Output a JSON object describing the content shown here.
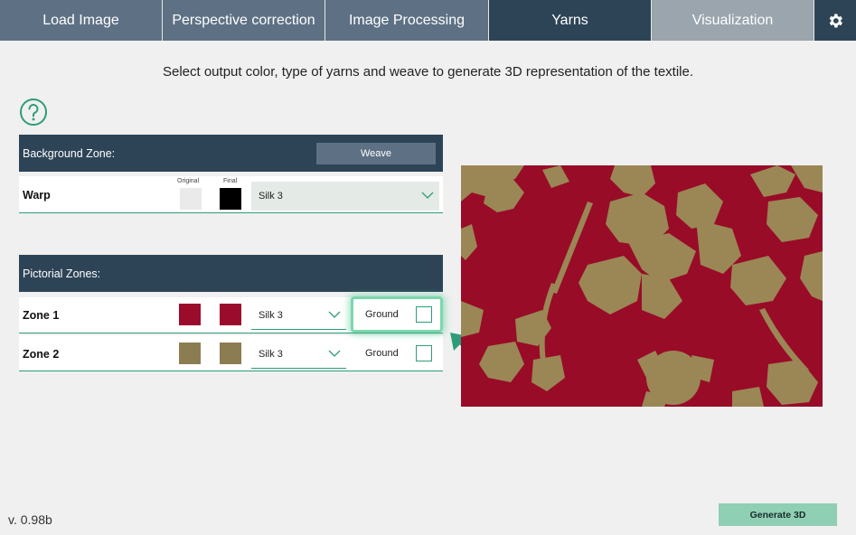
{
  "tabs": [
    {
      "label": "Load Image"
    },
    {
      "label": "Perspective correction"
    },
    {
      "label": "Image Processing"
    },
    {
      "label": "Yarns"
    },
    {
      "label": "Visualization"
    }
  ],
  "settings_icon": "gear-icon",
  "instructions": "Select output color, type of yarns and weave to generate 3D representation of the textile.",
  "help_icon": "question-circle-icon",
  "background_zone": {
    "title": "Background Zone:",
    "weave_label": "Weave",
    "original_caption": "Original",
    "final_caption": "Final",
    "warp": {
      "label": "Warp",
      "original_color": "#eaeaea",
      "final_color": "#000000",
      "yarn": "Silk 3"
    }
  },
  "pictorial_zones": {
    "title": "Pictorial Zones:",
    "ground_label": "Ground",
    "zones": [
      {
        "label": "Zone 1",
        "original_color": "#9b0c2c",
        "final_color": "#9b0c2c",
        "yarn": "Silk 3",
        "ground_checked": false
      },
      {
        "label": "Zone 2",
        "original_color": "#8c7c52",
        "final_color": "#8c7c52",
        "yarn": "Silk 3",
        "ground_checked": false
      }
    ]
  },
  "preview": {
    "ground_color": "#980c28",
    "motif_color": "#9a8755"
  },
  "colors": {
    "accent": "#2e9c78",
    "header": "#2d4456",
    "tab": "#5e7184"
  },
  "version": "v. 0.98b",
  "generate_label": "Generate 3D"
}
